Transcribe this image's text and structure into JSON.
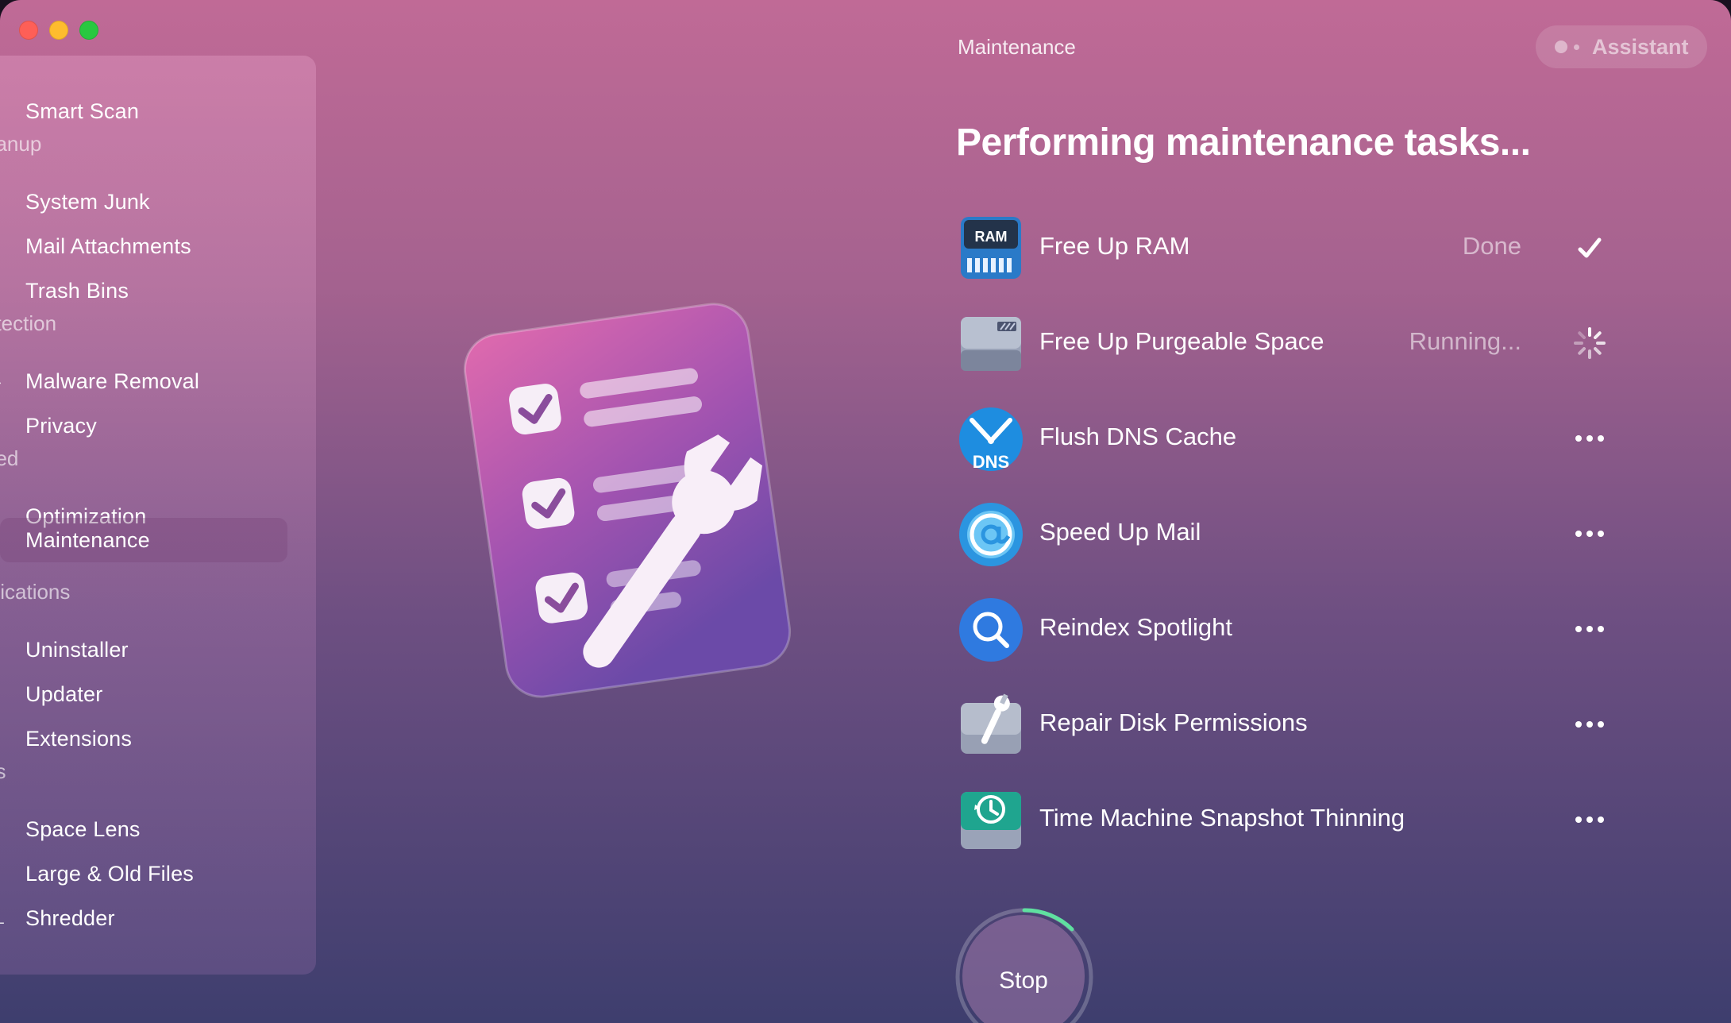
{
  "header": {
    "title": "Maintenance",
    "assistant_label": "Assistant"
  },
  "sidebar": {
    "items": [
      {
        "label": "Smart Scan",
        "icon": "smart-scan-icon"
      },
      {
        "label": "System Junk",
        "icon": "system-junk-icon"
      },
      {
        "label": "Mail Attachments",
        "icon": "mail-attachments-icon"
      },
      {
        "label": "Trash Bins",
        "icon": "trash-bins-icon"
      },
      {
        "label": "Malware Removal",
        "icon": "malware-removal-icon"
      },
      {
        "label": "Privacy",
        "icon": "privacy-icon"
      },
      {
        "label": "Optimization",
        "icon": "optimization-icon"
      },
      {
        "label": "Maintenance",
        "icon": "maintenance-icon",
        "active": true
      },
      {
        "label": "Uninstaller",
        "icon": "uninstaller-icon"
      },
      {
        "label": "Updater",
        "icon": "updater-icon"
      },
      {
        "label": "Extensions",
        "icon": "extensions-icon"
      },
      {
        "label": "Space Lens",
        "icon": "space-lens-icon"
      },
      {
        "label": "Large & Old Files",
        "icon": "large-old-files-icon"
      },
      {
        "label": "Shredder",
        "icon": "shredder-icon"
      }
    ],
    "sections": [
      "eanup",
      "otection",
      "eed",
      "plications",
      "es"
    ]
  },
  "main": {
    "headline": "Performing maintenance tasks...",
    "tasks": [
      {
        "label": "Free Up RAM",
        "status": "Done",
        "indicator": "checkmark-icon",
        "icon": "ram-icon"
      },
      {
        "label": "Free Up Purgeable Space",
        "status": "Running...",
        "indicator": "spinner-icon",
        "icon": "disk-drive-icon"
      },
      {
        "label": "Flush DNS Cache",
        "status": "",
        "indicator": "ellipsis-icon",
        "icon": "dns-icon"
      },
      {
        "label": "Speed Up Mail",
        "status": "",
        "indicator": "ellipsis-icon",
        "icon": "mail-at-icon"
      },
      {
        "label": "Reindex Spotlight",
        "status": "",
        "indicator": "ellipsis-icon",
        "icon": "spotlight-icon"
      },
      {
        "label": "Repair Disk Permissions",
        "status": "",
        "indicator": "ellipsis-icon",
        "icon": "disk-repair-icon"
      },
      {
        "label": "Time Machine Snapshot Thinning",
        "status": "",
        "indicator": "ellipsis-icon",
        "icon": "time-machine-icon"
      }
    ],
    "ram_chip_text": "RAM",
    "dns_badge_text": "DNS",
    "stop_label": "Stop"
  },
  "colors": {
    "accent_green": "#5fe0a0",
    "spotlight_blue": "#2f7ae0",
    "time_machine_teal": "#1fa58f"
  }
}
